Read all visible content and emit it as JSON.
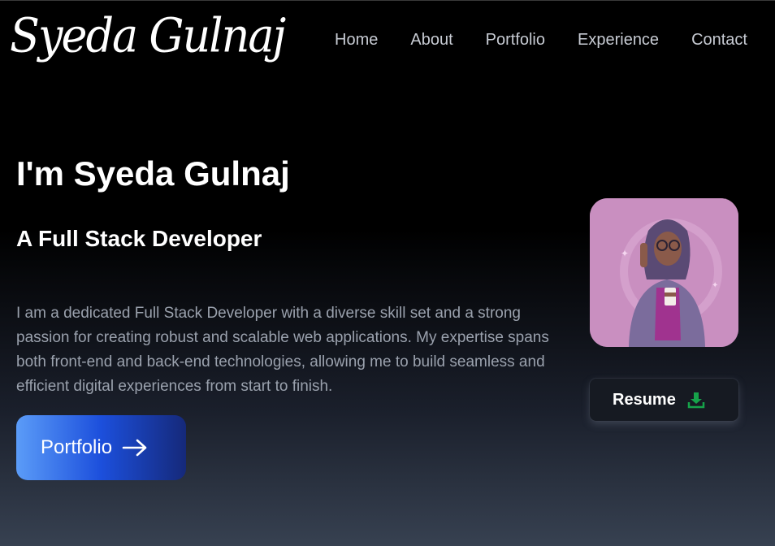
{
  "header": {
    "logo_text": "Syeda Gulnaj",
    "nav": [
      {
        "label": "Home"
      },
      {
        "label": "About"
      },
      {
        "label": "Portfolio"
      },
      {
        "label": "Experience"
      },
      {
        "label": "Contact"
      }
    ]
  },
  "hero": {
    "title": "I'm Syeda Gulnaj",
    "subtitle": "A Full Stack Developer",
    "description": "I am a dedicated Full Stack Developer with a diverse skill set and a strong passion for creating robust and scalable web applications. My expertise spans both front-end and back-end technologies, allowing me to build seamless and efficient digital experiences from start to finish.",
    "portfolio_button": {
      "label": "Portfolio",
      "icon": "arrow-right-icon"
    },
    "resume_button": {
      "label": "Resume",
      "icon": "download-icon",
      "icon_color": "#16a34a"
    }
  },
  "colors": {
    "background_top": "#000000",
    "background_bottom": "#374151",
    "nav_text": "#c7cbd3",
    "body_text": "#9aa1ad",
    "button_gradient_start": "#5b9cf8",
    "button_gradient_end": "#15297a"
  }
}
